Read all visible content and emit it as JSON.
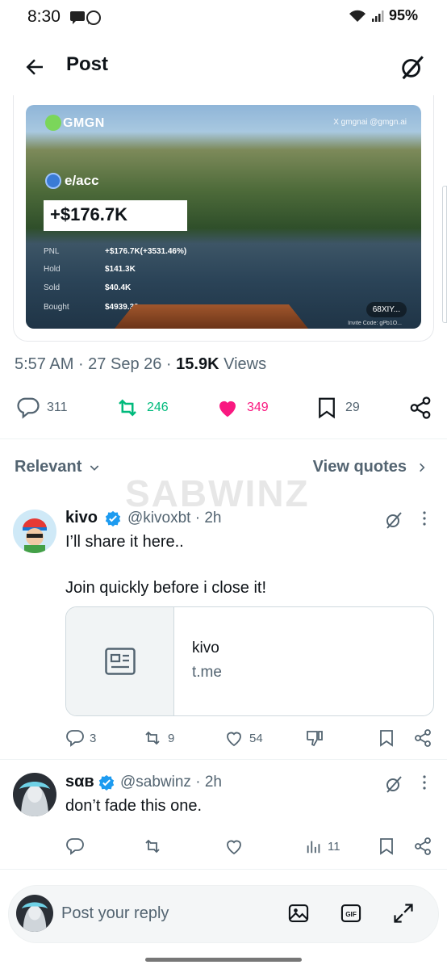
{
  "status": {
    "time": "8:30",
    "battery": "95%"
  },
  "header": {
    "title": "Post"
  },
  "media": {
    "brand": "GMGN",
    "handles": "X gmgnai   @gmgn.ai",
    "account": "e/acc",
    "pnl_headline": "+$176.7K",
    "stats": [
      {
        "label": "PNL",
        "value": "+$176.7K(+3531.46%)"
      },
      {
        "label": "Hold",
        "value": "$141.3K"
      },
      {
        "label": "Sold",
        "value": "$40.4K"
      },
      {
        "label": "Bought",
        "value": "$4939.39"
      }
    ],
    "invite": "68XIY...",
    "invite_code": "Invite Code: gPb1O..."
  },
  "meta": {
    "time": "5:57 AM",
    "date": "27 Sep 26",
    "views_count": "15.9K",
    "views_label": "Views"
  },
  "actions": {
    "replies": "311",
    "reposts": "246",
    "likes": "349",
    "bookmarks": "29"
  },
  "filter": {
    "sort": "Relevant",
    "quotes": "View quotes"
  },
  "watermark": "SABWINZ",
  "replies": [
    {
      "name": "kivo",
      "handle": "@kivoxbt",
      "time": "2h",
      "text1": "I’ll share it here..",
      "text2": "Join quickly before i close it!",
      "link_title": "kivo",
      "link_domain": "t.me",
      "replies": "3",
      "reposts": "9",
      "likes": "54"
    },
    {
      "name": "sαв",
      "handle": "@sabwinz",
      "time": "2h",
      "text1": "don’t fade this one.",
      "views": "11"
    }
  ],
  "composer": {
    "placeholder": "Post your reply"
  },
  "colors": {
    "repost": "#00ba7c",
    "like": "#f91880",
    "muted": "#536471",
    "verified": "#1d9bf0"
  }
}
